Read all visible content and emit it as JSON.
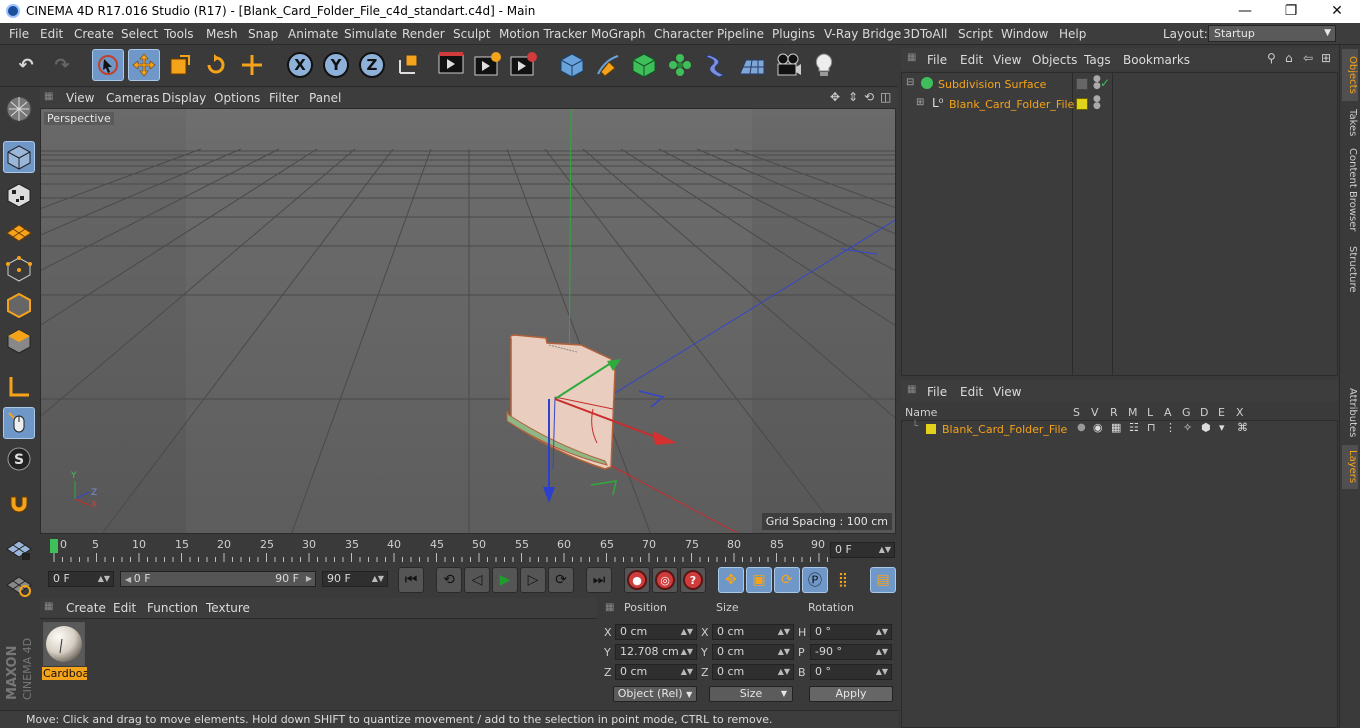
{
  "window": {
    "title": "CINEMA 4D R17.016 Studio (R17) - [Blank_Card_Folder_File_c4d_standart.c4d] - Main",
    "minimize": "—",
    "maximize": "❐",
    "close": "✕"
  },
  "menubar": {
    "items": [
      "File",
      "Edit",
      "Create",
      "Select",
      "Tools",
      "Mesh",
      "Snap",
      "Animate",
      "Simulate",
      "Render",
      "Sculpt",
      "Motion Tracker",
      "MoGraph",
      "Character",
      "Pipeline",
      "Plugins",
      "V-Ray Bridge",
      "3DToAll",
      "Script",
      "Window",
      "Help"
    ],
    "layout_label": "Layout:",
    "layout_value": "Startup"
  },
  "toolbar": {
    "axis_x": "X",
    "axis_y": "Y",
    "axis_z": "Z"
  },
  "viewport": {
    "menu": [
      "View",
      "Cameras",
      "Display",
      "Options",
      "Filter",
      "Panel"
    ],
    "label": "Perspective",
    "grid_spacing": "Grid Spacing : 100 cm",
    "axis_y": "Y",
    "axis_z": "Z",
    "axis_x": "X"
  },
  "timeline": {
    "ticks": [
      "0",
      "5",
      "10",
      "15",
      "20",
      "25",
      "30",
      "35",
      "40",
      "45",
      "50",
      "55",
      "60",
      "65",
      "70",
      "75",
      "80",
      "85",
      "90"
    ],
    "current_frame": "0 F"
  },
  "transport": {
    "start": "0 F",
    "range_start": "0 F",
    "range_end": "90 F",
    "end": "90 F"
  },
  "material_manager": {
    "menu": [
      "Create",
      "Edit",
      "Function",
      "Texture"
    ],
    "material_name": "Cardboard"
  },
  "coordinates": {
    "headers": {
      "position": "Position",
      "size": "Size",
      "rotation": "Rotation"
    },
    "rows": [
      {
        "axis": "X",
        "pos": "0 cm",
        "size_axis": "X",
        "size": "0 cm",
        "rot_axis": "H",
        "rot": "0 °"
      },
      {
        "axis": "Y",
        "pos": "12.708 cm",
        "size_axis": "Y",
        "size": "0 cm",
        "rot_axis": "P",
        "rot": "-90 °"
      },
      {
        "axis": "Z",
        "pos": "0 cm",
        "size_axis": "Z",
        "size": "0 cm",
        "rot_axis": "B",
        "rot": "0 °"
      }
    ],
    "mode": "Object (Rel)",
    "size_mode": "Size",
    "apply": "Apply"
  },
  "status": "Move: Click and drag to move elements. Hold down SHIFT to quantize movement / add to the selection in point mode, CTRL to remove.",
  "object_manager": {
    "menu": [
      "File",
      "Edit",
      "View",
      "Objects",
      "Tags",
      "Bookmarks"
    ],
    "objects": [
      {
        "name": "Subdivision Surface"
      },
      {
        "name": "Blank_Card_Folder_File"
      }
    ]
  },
  "layer_manager": {
    "menu": [
      "File",
      "Edit",
      "View"
    ],
    "columns": [
      "Name",
      "S",
      "V",
      "R",
      "M",
      "L",
      "A",
      "G",
      "D",
      "E",
      "X"
    ],
    "layers": [
      {
        "name": "Blank_Card_Folder_File",
        "color": "#e3d21c"
      }
    ]
  },
  "right_tabs": [
    "Objects",
    "Takes",
    "Content Browser",
    "Structure",
    "Attributes",
    "Layers"
  ],
  "brand": {
    "line1": "MAXON",
    "line2": "CINEMA 4D"
  },
  "colors": {
    "accent_orange": "#f5a31a",
    "selected_blue": "#6f98c8",
    "layer_yellow": "#e3d21c"
  }
}
